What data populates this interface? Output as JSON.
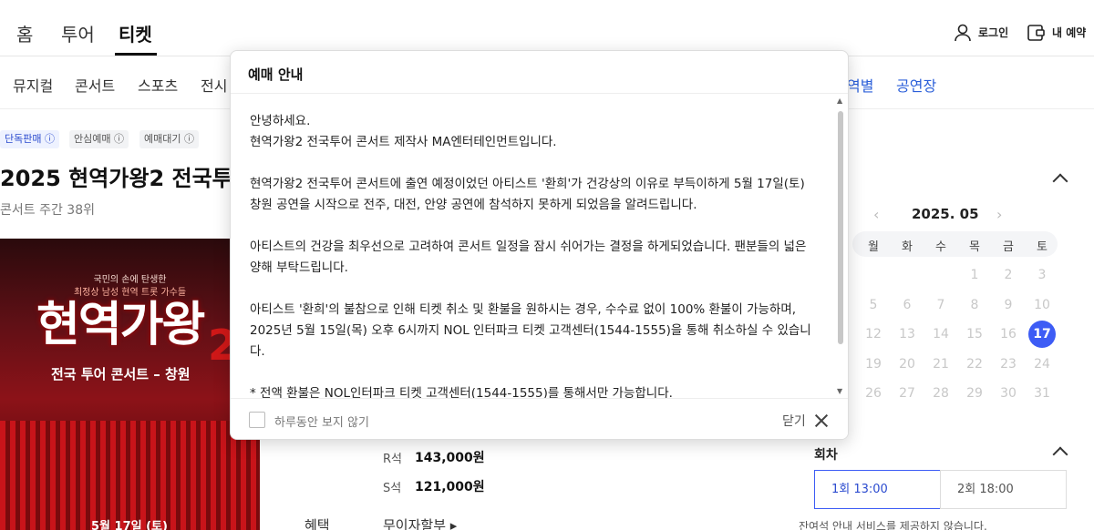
{
  "nav": {
    "items": [
      {
        "label": "홈"
      },
      {
        "label": "투어"
      },
      {
        "label": "티켓"
      }
    ],
    "login": "로그인",
    "myres": "내 예약"
  },
  "categories": [
    {
      "label": "뮤지컬"
    },
    {
      "label": "콘서트"
    },
    {
      "label": "스포츠"
    },
    {
      "label": "전시"
    },
    {
      "label": "역별"
    },
    {
      "label": "공연장"
    }
  ],
  "badges": [
    {
      "label": "단독판매 ⓘ"
    },
    {
      "label": "안심예매 ⓘ"
    },
    {
      "label": "예매대기 ⓘ"
    }
  ],
  "event": {
    "title": "2025 현역가왕2 전국투",
    "subtitle": "콘서트 주간 38위"
  },
  "poster": {
    "line1": "국민의 손에 탄생한",
    "line2": "최정상 남성 현역 트롯 가수들",
    "big": "현역가왕",
    "num": "2",
    "sub": "전국 투어 콘서트 – 창원",
    "date": "5월 17일 (토)"
  },
  "prices": [
    {
      "seat": "R석",
      "price": "143,000원"
    },
    {
      "seat": "S석",
      "price": "121,000원"
    }
  ],
  "benefit": {
    "label": "혜택",
    "value": "무이자할부 ▸"
  },
  "calendar": {
    "month": "2025. 05",
    "prev": "‹",
    "next": "›",
    "weekdays": [
      "월",
      "화",
      "수",
      "목",
      "금",
      "토"
    ],
    "rows": [
      [
        "",
        "",
        "",
        "1",
        "2",
        "3"
      ],
      [
        "5",
        "6",
        "7",
        "8",
        "9",
        "10"
      ],
      [
        "12",
        "13",
        "14",
        "15",
        "16",
        "17"
      ],
      [
        "19",
        "20",
        "21",
        "22",
        "23",
        "24"
      ],
      [
        "26",
        "27",
        "28",
        "29",
        "30",
        "31"
      ]
    ],
    "selected": "17"
  },
  "sessions": {
    "heading": "회차",
    "items": [
      {
        "label": "1회 13:00"
      },
      {
        "label": "2회 18:00"
      }
    ],
    "footnote": "잔여석 안내 서비스를 제공하지 않습니다."
  },
  "modal": {
    "title": "예매 안내",
    "paragraphs": [
      "안녕하세요.",
      "현역가왕2 전국투어 콘서트 제작사 MA엔터테인먼트입니다.",
      "",
      "현역가왕2 전국투어 콘서트에 출연 예정이었던 아티스트 '환희'가 건강상의 이유로 부득이하게 5월 17일(토) 창원 공연을 시작으로 전주, 대전, 안양 공연에 참석하지 못하게 되었음을 알려드립니다.",
      "",
      "아티스트의 건강을 최우선으로 고려하여 콘서트 일정을 잠시 쉬어가는 결정을 하게되었습니다. 팬분들의 넓은 양해 부탁드립니다.",
      "",
      "아티스트 '환희'의 불참으로 인해 티켓 취소 및 환불을 원하시는 경우, 수수료 없이 100% 환불이 가능하며, 2025년 5월 15일(목) 오후 6시까지 NOL 인터파크 티켓 고객센터(1544-1555)을 통해 취소하실 수 있습니다.",
      "",
      "* 전액 환불은 NOL인터파크 티켓 고객센터(1544-1555)를 통해서만 가능합니다."
    ],
    "dont_show": "하루동안 보지 않기",
    "close": "닫기"
  }
}
